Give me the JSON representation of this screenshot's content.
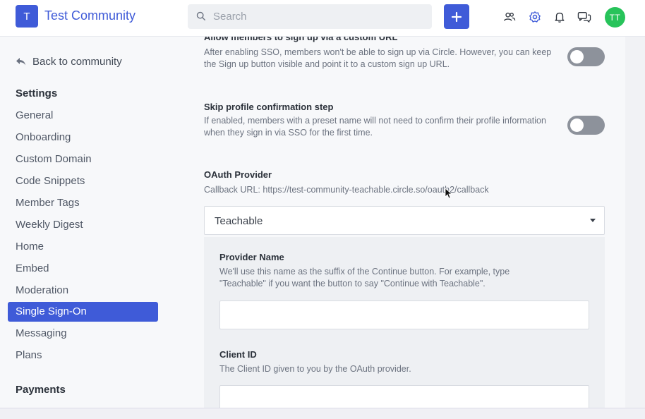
{
  "header": {
    "logo_letter": "T",
    "community_name": "Test Community",
    "search_placeholder": "Search",
    "avatar_initials": "TT",
    "icons": [
      "members-icon",
      "settings-gear-icon",
      "bell-icon",
      "chat-icon"
    ]
  },
  "sidebar": {
    "back_label": "Back to community",
    "settings_heading": "Settings",
    "items": [
      {
        "label": "General"
      },
      {
        "label": "Onboarding"
      },
      {
        "label": "Custom Domain"
      },
      {
        "label": "Code Snippets"
      },
      {
        "label": "Member Tags"
      },
      {
        "label": "Weekly Digest"
      },
      {
        "label": "Home"
      },
      {
        "label": "Embed"
      },
      {
        "label": "Moderation"
      },
      {
        "label": "Single Sign-On",
        "active": true
      },
      {
        "label": "Messaging"
      },
      {
        "label": "Plans"
      }
    ],
    "payments_heading": "Payments"
  },
  "main": {
    "signup_url": {
      "title": "Allow members to sign up via a custom URL",
      "description": "After enabling SSO, members won't be able to sign up via Circle. However, you can keep the Sign up button visible and point it to a custom sign up URL.",
      "enabled": false
    },
    "skip_profile": {
      "title": "Skip profile confirmation step",
      "description": "If enabled, members with a preset name will not need to confirm their profile information when they sign in via SSO for the first time.",
      "enabled": false
    },
    "oauth": {
      "title": "OAuth Provider",
      "callback": "Callback URL: https://test-community-teachable.circle.so/oauth2/callback",
      "selected_provider": "Teachable"
    },
    "provider_name": {
      "title": "Provider Name",
      "description": "We'll use this name as the suffix of the Continue button. For example, type \"Teachable\" if you want the button to say \"Continue with Teachable\".",
      "value": ""
    },
    "client_id": {
      "title": "Client ID",
      "description": "The Client ID given to you by the OAuth provider.",
      "value": ""
    }
  },
  "colors": {
    "accent": "#3f5bd8",
    "avatar": "#27c35a",
    "toggle_off": "#8d929b"
  }
}
